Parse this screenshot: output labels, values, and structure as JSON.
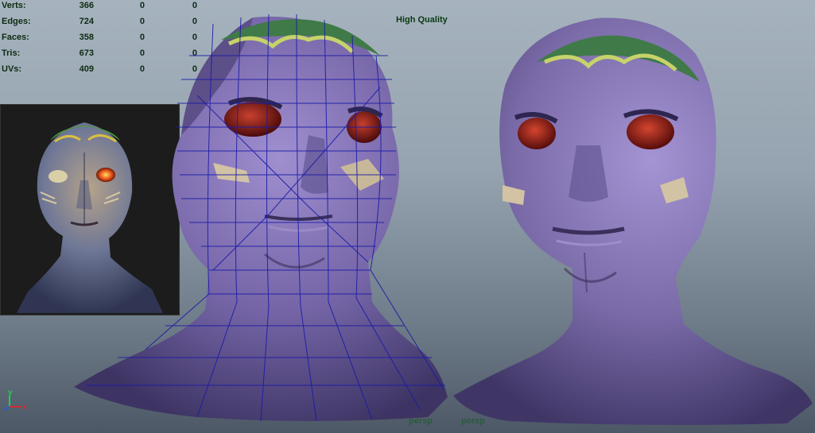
{
  "hud": {
    "rows": [
      {
        "label": "Verts:",
        "v1": "366",
        "v2": "0",
        "v3": "0"
      },
      {
        "label": "Edges:",
        "v1": "724",
        "v2": "0",
        "v3": "0"
      },
      {
        "label": "Faces:",
        "v1": "358",
        "v2": "0",
        "v3": "0"
      },
      {
        "label": "Tris:",
        "v1": "673",
        "v2": "0",
        "v3": "0"
      },
      {
        "label": "UVs:",
        "v1": "409",
        "v2": "0",
        "v3": "0"
      }
    ]
  },
  "viewport": {
    "quality_label": "High Quality",
    "camera_left": "persp",
    "camera_right": "persp"
  },
  "axis": {
    "x": "x",
    "y": "y"
  },
  "colors": {
    "skin": "#7a6aa8",
    "skin_dark": "#4f4479",
    "wireframe": "#1a1aa8",
    "eye": "#9a1d1a",
    "hud_text": "#0d2a10"
  }
}
